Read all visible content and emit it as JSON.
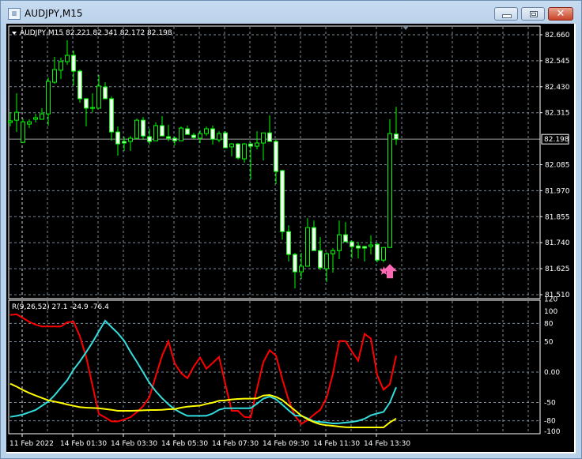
{
  "window": {
    "title": "AUDJPY,M15",
    "icon": "chart-window-icon",
    "buttons": [
      "minimize-icon",
      "maximize-icon",
      "close-icon"
    ]
  },
  "colors": {
    "background": "#000000",
    "grid": "#7a8a9a",
    "candle_outline": "#00ff00",
    "bear_body": "#ffffff",
    "bull_body": "#000000",
    "red_line": "#ff0000",
    "cyan_line": "#33dddd",
    "yellow_line": "#ffff00",
    "signal": "#ff69b4"
  },
  "chart_data": [
    {
      "type": "candlestick",
      "header": "AUDJPY,M15  82.221 82.341 82.172 82.198",
      "symbol": "AUDJPY,M15",
      "ylim": [
        81.51,
        82.66
      ],
      "y_ticks": [
        "82.660",
        "82.545",
        "82.430",
        "82.315",
        "82.200",
        "82.085",
        "81.970",
        "81.855",
        "81.740",
        "81.625",
        "81.510"
      ],
      "current_price": "82.198",
      "grid": true,
      "ohlc": [
        [
          82.272,
          82.317,
          82.254,
          82.279
        ],
        [
          82.282,
          82.401,
          82.23,
          82.317
        ],
        [
          82.184,
          82.289,
          82.184,
          82.275
        ],
        [
          82.265,
          82.286,
          82.247,
          82.275
        ],
        [
          82.286,
          82.31,
          82.272,
          82.293
        ],
        [
          82.286,
          82.335,
          82.286,
          82.31
        ],
        [
          82.31,
          82.471,
          82.258,
          82.454
        ],
        [
          82.45,
          82.562,
          82.443,
          82.506
        ],
        [
          82.503,
          82.559,
          82.464,
          82.541
        ],
        [
          82.541,
          82.636,
          82.527,
          82.569
        ],
        [
          82.569,
          82.59,
          82.436,
          82.499
        ],
        [
          82.499,
          82.506,
          82.359,
          82.377
        ],
        [
          82.377,
          82.38,
          82.254,
          82.335
        ],
        [
          82.338,
          82.401,
          82.317,
          82.338
        ],
        [
          82.335,
          82.482,
          82.335,
          82.433
        ],
        [
          82.429,
          82.45,
          82.377,
          82.377
        ],
        [
          82.377,
          82.387,
          82.191,
          82.23
        ],
        [
          82.23,
          82.254,
          82.125,
          82.177
        ],
        [
          82.188,
          82.209,
          82.146,
          82.181
        ],
        [
          82.188,
          82.212,
          82.146,
          82.202
        ],
        [
          82.202,
          82.289,
          82.202,
          82.282
        ],
        [
          82.282,
          82.296,
          82.195,
          82.212
        ],
        [
          82.209,
          82.244,
          82.174,
          82.188
        ],
        [
          82.191,
          82.272,
          82.191,
          82.258
        ],
        [
          82.258,
          82.3,
          82.212,
          82.212
        ],
        [
          82.209,
          82.261,
          82.188,
          82.202
        ],
        [
          82.202,
          82.209,
          82.17,
          82.191
        ],
        [
          82.191,
          82.254,
          82.191,
          82.247
        ],
        [
          82.244,
          82.258,
          82.219,
          82.219
        ],
        [
          82.216,
          82.226,
          82.198,
          82.205
        ],
        [
          82.202,
          82.237,
          82.181,
          82.223
        ],
        [
          82.223,
          82.254,
          82.212,
          82.244
        ],
        [
          82.244,
          82.258,
          82.174,
          82.198
        ],
        [
          82.195,
          82.233,
          82.184,
          82.223
        ],
        [
          82.226,
          82.233,
          82.16,
          82.16
        ],
        [
          82.164,
          82.181,
          82.122,
          82.177
        ],
        [
          82.177,
          82.181,
          82.108,
          82.115
        ],
        [
          82.111,
          82.181,
          82.094,
          82.177
        ],
        [
          82.177,
          82.184,
          82.02,
          82.167
        ],
        [
          82.167,
          82.233,
          82.153,
          82.181
        ],
        [
          82.181,
          82.226,
          82.104,
          82.226
        ],
        [
          82.226,
          82.303,
          82.188,
          82.188
        ],
        [
          82.188,
          82.195,
          81.999,
          82.055
        ],
        [
          82.059,
          82.062,
          81.754,
          81.789
        ],
        [
          81.789,
          81.817,
          81.657,
          81.688
        ],
        [
          81.688,
          81.695,
          81.538,
          81.611
        ],
        [
          81.611,
          81.695,
          81.58,
          81.636
        ],
        [
          81.636,
          81.849,
          81.636,
          81.807
        ],
        [
          81.807,
          81.838,
          81.705,
          81.705
        ],
        [
          81.705,
          81.765,
          81.618,
          81.629
        ],
        [
          81.625,
          81.698,
          81.566,
          81.691
        ],
        [
          81.691,
          81.716,
          81.608,
          81.705
        ],
        [
          81.705,
          81.838,
          81.667,
          81.775
        ],
        [
          81.775,
          81.831,
          81.744,
          81.744
        ],
        [
          81.744,
          81.75,
          81.671,
          81.723
        ],
        [
          81.726,
          81.744,
          81.671,
          81.716
        ],
        [
          81.723,
          81.726,
          81.657,
          81.716
        ],
        [
          81.723,
          81.772,
          81.688,
          81.73
        ],
        [
          81.733,
          81.74,
          81.653,
          81.663
        ],
        [
          81.663,
          81.719,
          81.653,
          81.719
        ],
        [
          81.719,
          82.286,
          81.719,
          82.223
        ],
        [
          82.221,
          82.341,
          82.172,
          82.198
        ]
      ],
      "signals": [
        {
          "bar": 59,
          "type": "star"
        },
        {
          "bar": 60,
          "type": "up-arrow"
        }
      ]
    },
    {
      "type": "line",
      "header": "R(9,26,52) 27.1 -24.9 -76.4",
      "ylim": [
        -100,
        120
      ],
      "y_ticks": [
        "120",
        "100",
        "80",
        "50",
        "0.00",
        "-50",
        "-80",
        "-100"
      ],
      "grid": true,
      "series": [
        {
          "color": "#ff0000",
          "values": [
            94,
            95,
            89,
            82.6,
            78,
            75,
            75,
            75,
            75,
            81.8,
            83,
            58.8,
            25,
            -22.5,
            -68.8,
            -74.5,
            -81,
            -81,
            -78,
            -74,
            -66,
            -55.8,
            -41,
            -6.5,
            27,
            50.6,
            14.3,
            -1.7,
            -10,
            9,
            24,
            5.6,
            15,
            25,
            -20,
            -63.6,
            -63.6,
            -73.6,
            -74.5,
            -27,
            16.4,
            36,
            27,
            -11.6,
            -46,
            -72,
            -85,
            -79,
            -70,
            -62,
            -42,
            -3,
            51,
            51,
            33.8,
            18.7,
            62.8,
            55,
            -5,
            -29,
            -20,
            27.1
          ]
        },
        {
          "color": "#33dddd",
          "values": [
            -73.6,
            -72,
            -69.6,
            -66,
            -62.3,
            -55.4,
            -48.5,
            -38,
            -25.5,
            -13.4,
            4,
            17.7,
            32.9,
            49,
            67,
            84.4,
            74,
            64,
            51.5,
            33.4,
            17,
            -0.4,
            -17.6,
            -31.6,
            -43,
            -52.8,
            -61,
            -67,
            -72,
            -72,
            -72,
            -71.8,
            -68,
            -62,
            -59.3,
            -59.3,
            -59.3,
            -59.3,
            -59.3,
            -52,
            -43.7,
            -40.3,
            -44.6,
            -53.7,
            -62.8,
            -71.4,
            -72,
            -76,
            -81,
            -82,
            -83,
            -84.4,
            -84,
            -83,
            -82,
            -80,
            -76.8,
            -71,
            -68,
            -65.4,
            -50,
            -24.9
          ]
        },
        {
          "color": "#ffff00",
          "values": [
            -19.1,
            -23.9,
            -29.5,
            -34.3,
            -38.6,
            -42.5,
            -46.4,
            -48.5,
            -50.6,
            -53.2,
            -55.4,
            -57.6,
            -58.4,
            -58.9,
            -59.3,
            -60.6,
            -61.9,
            -63.6,
            -63.6,
            -63.6,
            -63.2,
            -62.8,
            -62.3,
            -62.3,
            -61.9,
            -61,
            -60.6,
            -58.4,
            -56.7,
            -55.8,
            -55,
            -52.4,
            -50.2,
            -47.2,
            -46.4,
            -45,
            -44.2,
            -43.7,
            -43.7,
            -43.3,
            -38.6,
            -37.7,
            -40.8,
            -46,
            -54.5,
            -62.8,
            -71.4,
            -77.5,
            -82.2,
            -85.7,
            -87.4,
            -88.3,
            -89.6,
            -90.5,
            -90.9,
            -90.9,
            -90.9,
            -90.9,
            -90.9,
            -90.9,
            -82.7,
            -76.4
          ]
        }
      ]
    }
  ],
  "x_ticks": [
    "11 Feb 2022",
    "14 Feb 01:30",
    "14 Feb 03:30",
    "14 Feb 05:30",
    "14 Feb 07:30",
    "14 Feb 09:30",
    "14 Feb 11:30",
    "14 Feb 13:30"
  ]
}
